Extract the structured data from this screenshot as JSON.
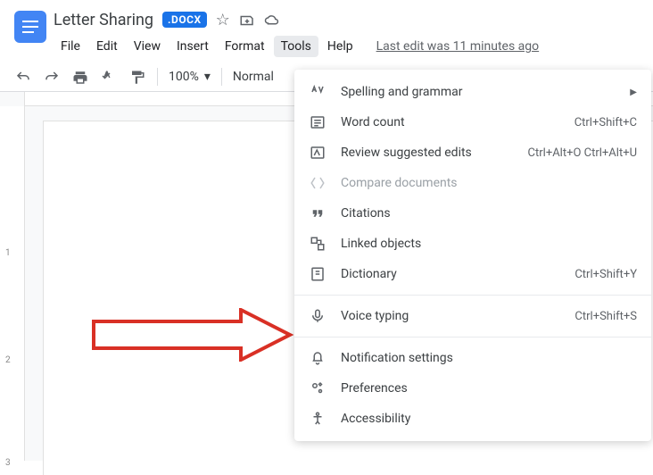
{
  "doc": {
    "title": "Letter Sharing",
    "badge": ".DOCX",
    "last_edit": "Last edit was 11 minutes ago"
  },
  "menus": {
    "file": "File",
    "edit": "Edit",
    "view": "View",
    "insert": "Insert",
    "format": "Format",
    "tools": "Tools",
    "help": "Help"
  },
  "toolbar": {
    "zoom": "100%",
    "style": "Normal"
  },
  "tools_menu": {
    "spelling": "Spelling and grammar",
    "word_count": "Word count",
    "word_count_sc": "Ctrl+Shift+C",
    "review": "Review suggested edits",
    "review_sc": "Ctrl+Alt+O Ctrl+Alt+U",
    "compare": "Compare documents",
    "citations": "Citations",
    "linked": "Linked objects",
    "dictionary": "Dictionary",
    "dictionary_sc": "Ctrl+Shift+Y",
    "voice": "Voice typing",
    "voice_sc": "Ctrl+Shift+S",
    "notifications": "Notification settings",
    "preferences": "Preferences",
    "accessibility": "Accessibility"
  },
  "ruler": {
    "t1": "1",
    "t2": "2",
    "t3": "3"
  }
}
